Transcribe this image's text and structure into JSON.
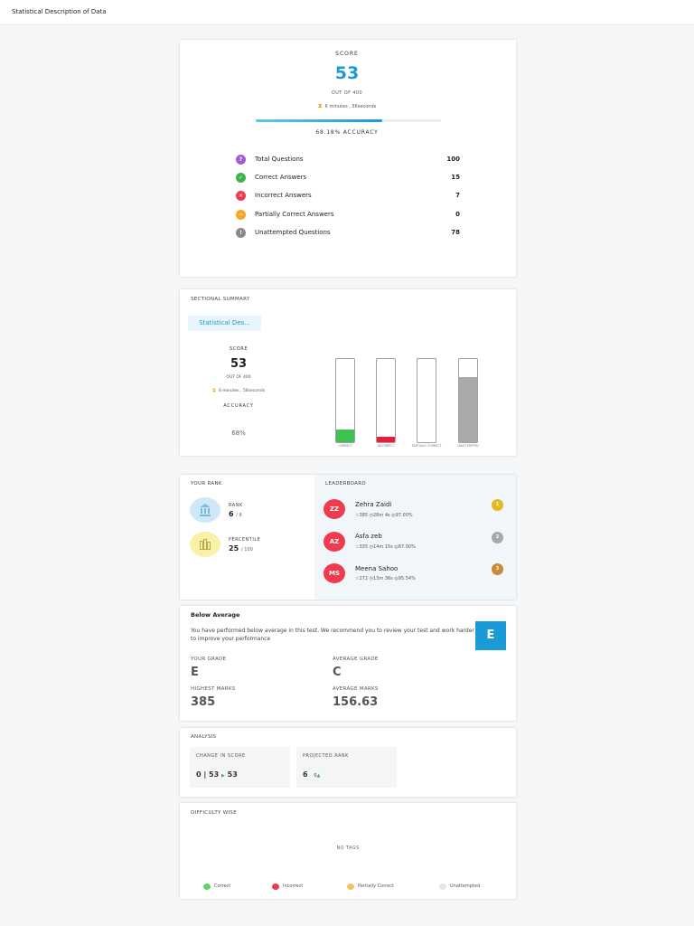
{
  "header": {
    "title": "Statistical Description of Data"
  },
  "score": {
    "label": "SCORE",
    "value": "53",
    "out_of": "OUT OF 400",
    "time": "6 minutes , 56seconds",
    "accuracy_fraction": 0.6818,
    "accuracy_text": "68.18% ACCURACY",
    "stats": [
      {
        "label": "Total Questions",
        "value": "100",
        "icon": "question-icon",
        "color": "#a05fd0"
      },
      {
        "label": "Correct Answers",
        "value": "15",
        "icon": "check-icon",
        "color": "#3bb54a"
      },
      {
        "label": "Incorrect Answers",
        "value": "7",
        "icon": "cross-icon",
        "color": "#ee3c4e"
      },
      {
        "label": "Partially Correct Answers",
        "value": "0",
        "icon": "tilde-icon",
        "color": "#f5a623"
      },
      {
        "label": "Unattempted Questions",
        "value": "78",
        "icon": "info-icon",
        "color": "#8a8a8a"
      }
    ]
  },
  "sectional": {
    "title": "SECTIONAL SUMMARY",
    "tab": "Statistical Des...",
    "score_label": "SCORE",
    "score_value": "53",
    "out_of": "OUT OF 400",
    "time": "6 minutes , 56seconds",
    "accuracy_label": "ACCURACY",
    "accuracy_value": "68%",
    "bars": [
      {
        "label": "CORRECT",
        "fraction": 0.15,
        "color": "#3ec24f"
      },
      {
        "label": "INCORRECT",
        "fraction": 0.07,
        "color": "#ee1c3a"
      },
      {
        "label": "PARTIALLY CORRECT",
        "fraction": 0.0,
        "color": "#f5a623"
      },
      {
        "label": "UNATTEMPTED",
        "fraction": 0.78,
        "color": "#aaaaaa"
      }
    ]
  },
  "rank": {
    "title": "YOUR RANK",
    "rank_label": "RANK",
    "rank_value": "6",
    "rank_total": "/ 8",
    "percentile_label": "PERCENTILE",
    "percentile_value": "25",
    "percentile_total": "/ 100"
  },
  "leaderboard": {
    "title": "LEADERBOARD",
    "entries": [
      {
        "initials": "ZZ",
        "name": "Zehra Zaidi",
        "score": "385",
        "time": "28m 4s",
        "accuracy": "97.00%",
        "medal": "1",
        "medal_color": "#e8b820"
      },
      {
        "initials": "AZ",
        "name": "Asfa zeb",
        "score": "335",
        "time": "14m 15s",
        "accuracy": "87.00%",
        "medal": "2",
        "medal_color": "#a8a8a8"
      },
      {
        "initials": "MS",
        "name": "Meena Sahoo",
        "score": "272",
        "time": "13m 36s",
        "accuracy": "95.54%",
        "medal": "3",
        "medal_color": "#c98a3a"
      }
    ]
  },
  "below": {
    "title": "Below Average",
    "message": "You have performed below average in this test. We recommend you to review your test and work harder to improve your performance",
    "badge": "E",
    "your_grade_label": "YOUR GRADE",
    "your_grade": "E",
    "avg_grade_label": "AVERAGE GRADE",
    "avg_grade": "C",
    "highest_label": "HIGHEST MARKS",
    "highest": "385",
    "avg_marks_label": "AVERAGE MARKS",
    "avg_marks": "156.63"
  },
  "analysis": {
    "title": "ANALYSIS",
    "change_label": "CHANGE IN SCORE",
    "change_from": "0 | 53",
    "change_to": "53",
    "projected_label": "PROJECTED RANK",
    "projected_value": "6",
    "projected_delta": "0"
  },
  "difficulty": {
    "title": "DIFFICULTY WISE",
    "empty": "NO TAGS",
    "legend": [
      {
        "label": "Correct",
        "color": "#5fd36a"
      },
      {
        "label": "Incorrect",
        "color": "#ee3c4e"
      },
      {
        "label": "Partially Correct",
        "color": "#f5c063"
      },
      {
        "label": "Unattempted",
        "color": "#e6e6e6"
      }
    ]
  }
}
